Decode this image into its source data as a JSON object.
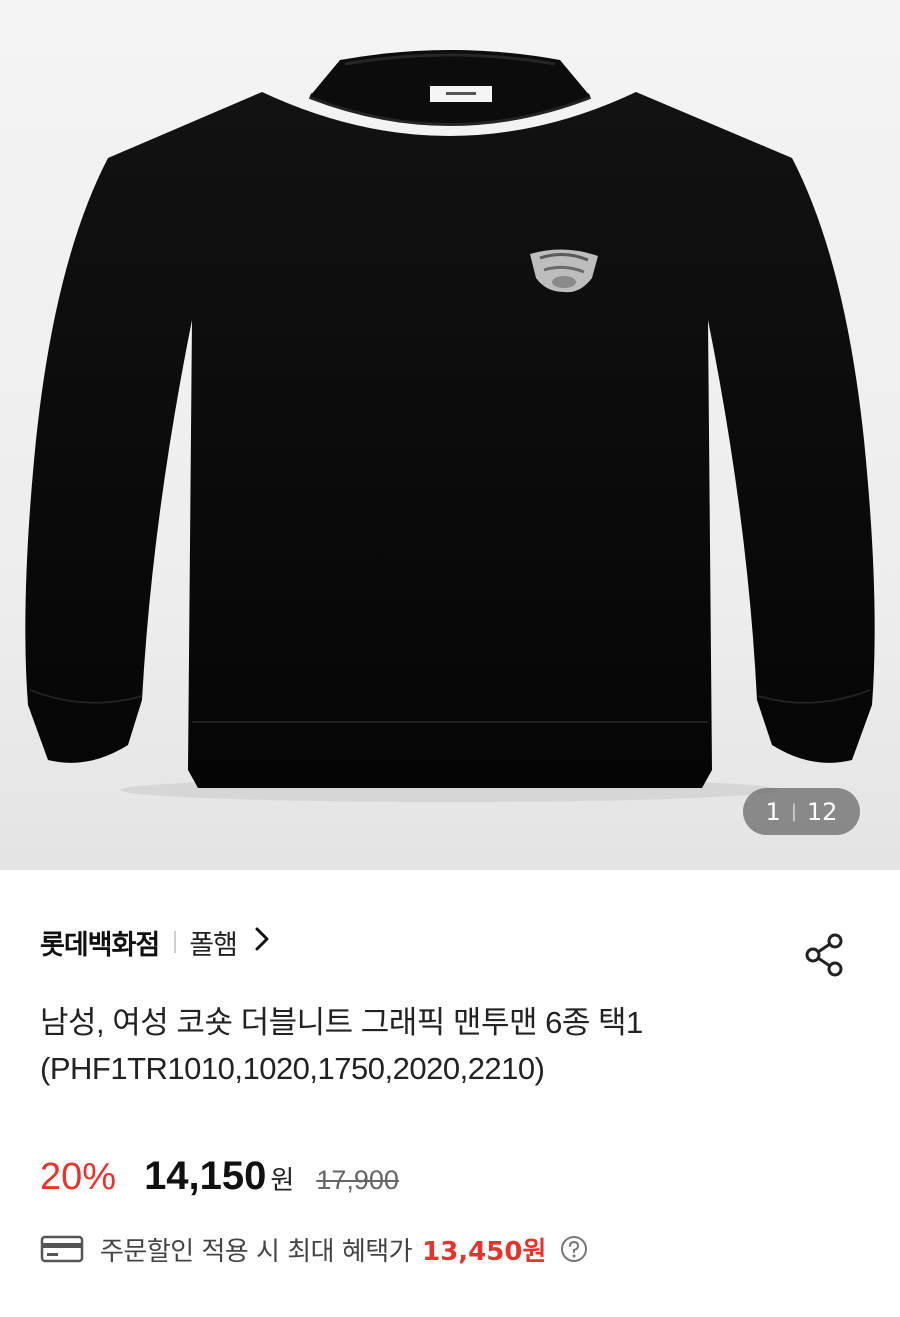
{
  "gallery": {
    "current": "1",
    "separator": "|",
    "total": "12"
  },
  "product": {
    "store": "롯데백화점",
    "brand": "폴햄",
    "title_line1": "남성, 여성 코숏 더블니트 그래픽 맨투맨 6종 택1",
    "title_line2": "(PHF1TR1010,1020,1750,2020,2210)"
  },
  "price": {
    "discount": "20%",
    "sale": "14,150",
    "won": "원",
    "original": "17,900",
    "accent_color": "#e5342e"
  },
  "benefit": {
    "text": "주문할인 적용 시 최대 혜택가",
    "amount": "13,450원"
  },
  "icons": {
    "share": "share-icon",
    "card": "card-icon",
    "help": "question-circle-icon",
    "chevron": "chevron-right-icon"
  }
}
